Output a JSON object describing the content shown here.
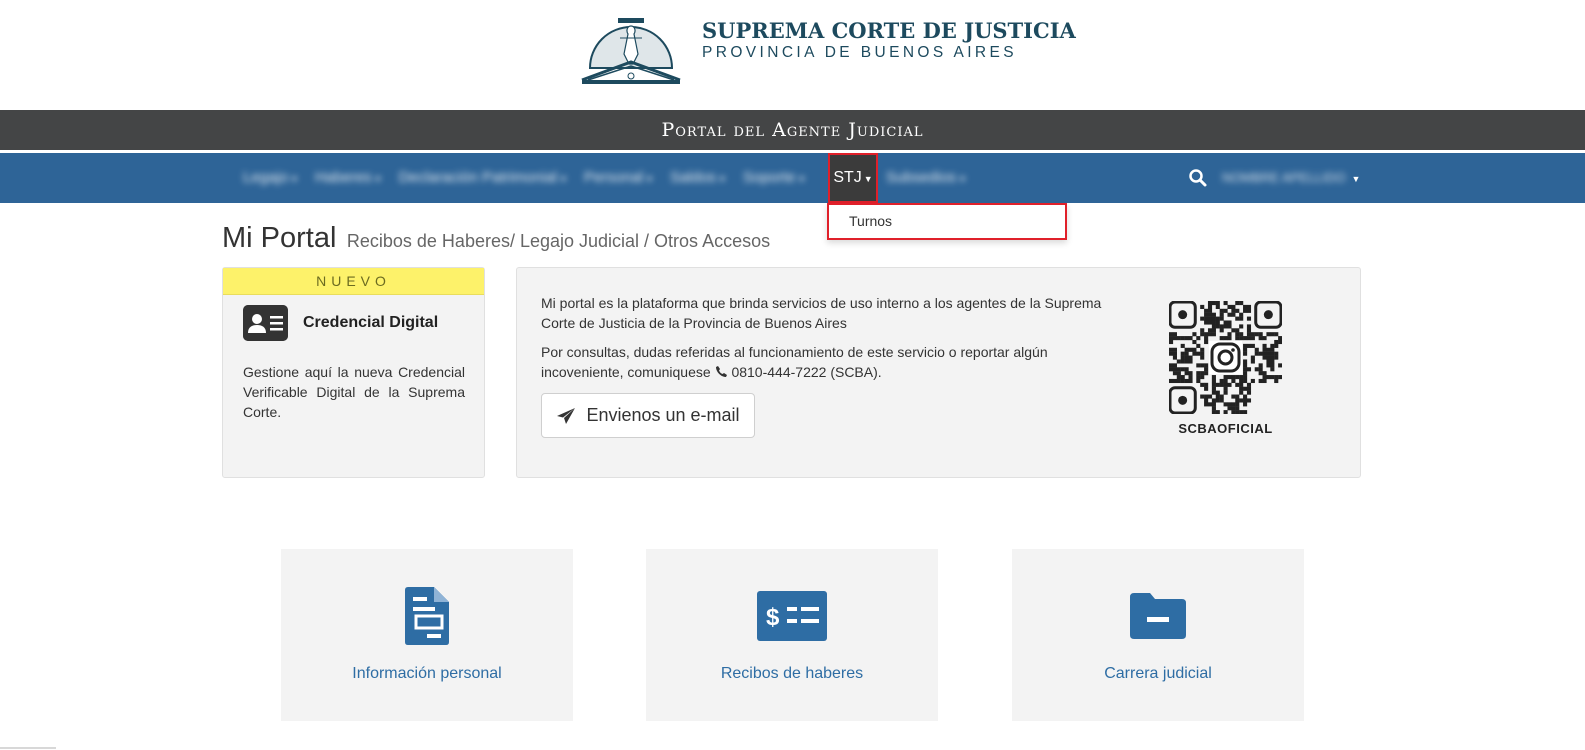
{
  "header": {
    "logo_title": "SUPREMA CORTE DE JUSTICIA",
    "logo_subtitle": "PROVINCIA DE BUENOS AIRES"
  },
  "portal_band": {
    "title": "Portal del Agente Judicial"
  },
  "nav": {
    "items": [
      {
        "label": "Legajo"
      },
      {
        "label": "Haberes"
      },
      {
        "label": "Declaración Patrimonial"
      },
      {
        "label": "Personal"
      },
      {
        "label": "Saldos"
      },
      {
        "label": "Soporte"
      }
    ],
    "active_item": "STJ",
    "after_item": "Subsedios",
    "user_name": "NOMBRE APELLIDO",
    "dropdown_items": [
      {
        "label": "Turnos"
      }
    ]
  },
  "page": {
    "title": "Mi Portal",
    "subtitle": "Recibos de Haberes/ Legajo Judicial / Otros Accesos"
  },
  "credential_card": {
    "badge": "NUEVO",
    "title": "Credencial Digital",
    "text": "Gestione aquí la nueva Credencial Verificable Digital de la Suprema Corte."
  },
  "info_card": {
    "paragraph1": "Mi portal es la plataforma que brinda servicios de uso interno a los agentes de la Suprema Corte de Justicia de la Provincia de Buenos Aires",
    "paragraph2_prefix": "Por consultas, dudas referidas al funcionamiento de este servicio o reportar algún incoveniente, comuniquese",
    "phone": "0810-444-7222 (SCBA).",
    "email_button": "Envienos un e-mail",
    "qr_label": "SCBAOFICIAL"
  },
  "tiles": [
    {
      "label": "Información personal",
      "icon": "document-icon"
    },
    {
      "label": "Recibos de haberes",
      "icon": "money-bill-icon"
    },
    {
      "label": "Carrera judicial",
      "icon": "folder-icon"
    }
  ],
  "colors": {
    "navbar": "#2e6497",
    "band": "#444546",
    "accent_blue": "#2e6da4",
    "new_badge": "#fdf26a",
    "highlight_red": "#e0202a"
  }
}
